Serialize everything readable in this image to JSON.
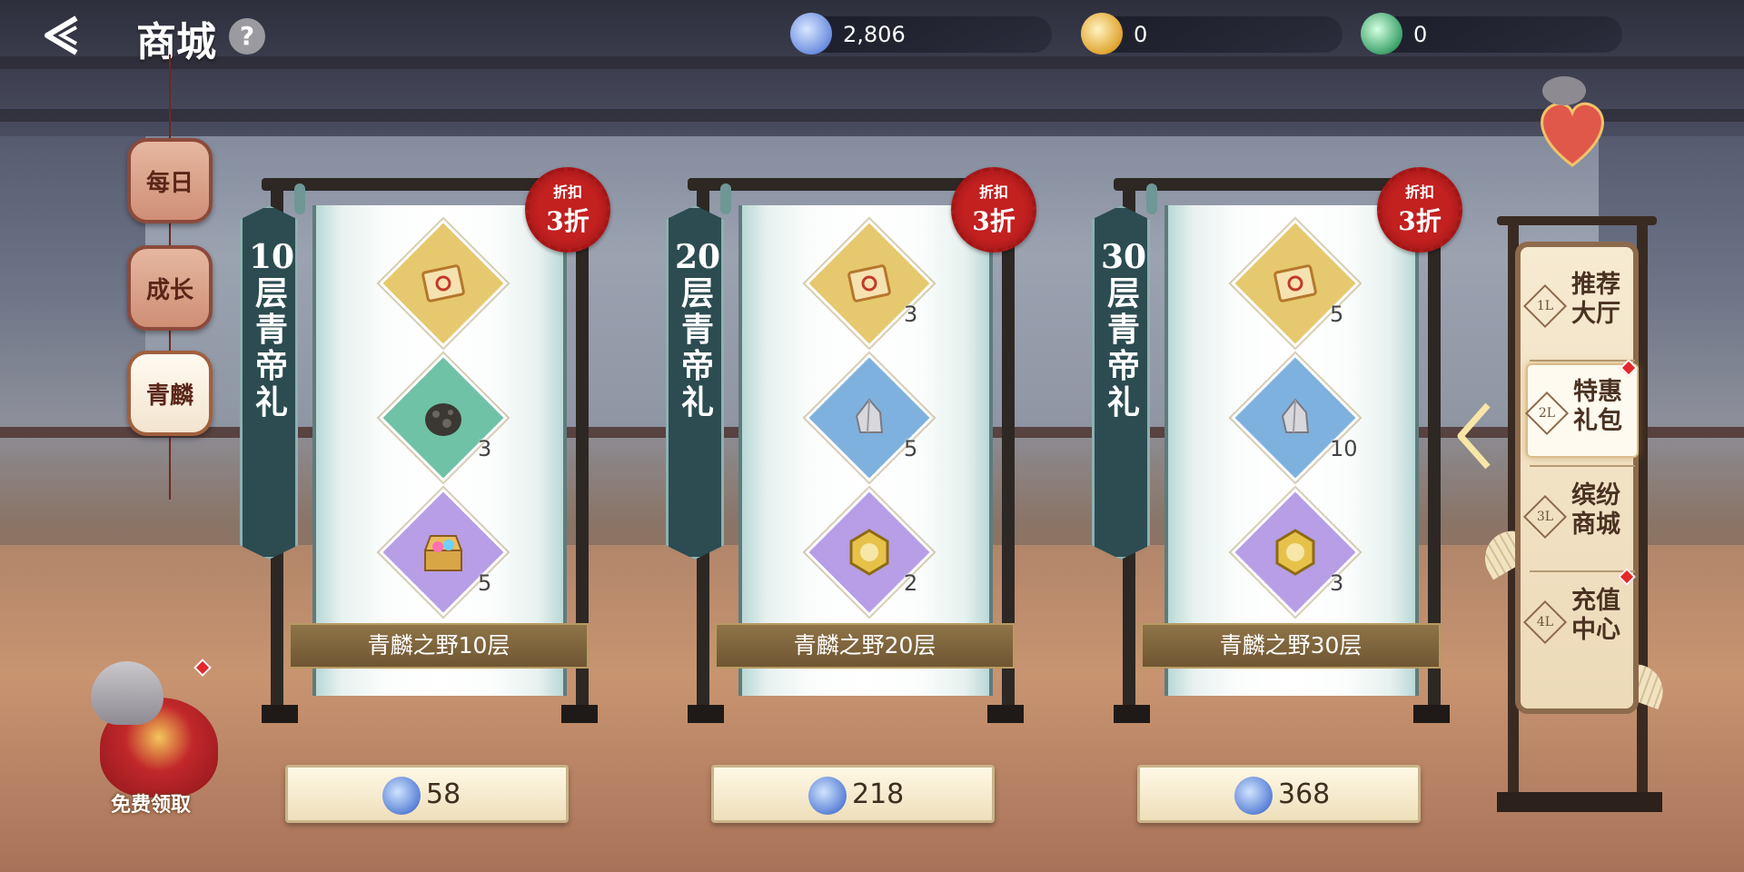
{
  "header": {
    "title": "商城",
    "help_label": "?",
    "currencies": [
      {
        "icon": "dragon-jade-icon",
        "value": "2,806",
        "color": "#6d8fe0"
      },
      {
        "icon": "gold-coin-icon",
        "value": "0",
        "color": "#e0a531"
      },
      {
        "icon": "green-orb-icon",
        "value": "0",
        "color": "#3fa36b"
      }
    ]
  },
  "categories": [
    {
      "label": "每日",
      "active": false
    },
    {
      "label": "成长",
      "active": false
    },
    {
      "label": "青麟",
      "active": true
    }
  ],
  "packages": [
    {
      "banner": "10层青帝礼",
      "badge_top": "折扣",
      "badge_bottom": "3折",
      "items": [
        {
          "icon": "ticket-icon",
          "qty": "",
          "bg": "#e6c86e"
        },
        {
          "icon": "ore-stone-icon",
          "qty": "3",
          "bg": "#6fc2a6"
        },
        {
          "icon": "treasure-chest-icon",
          "qty": "5",
          "bg": "#b79ee6"
        }
      ],
      "floor_label": "青麟之野10层",
      "price": "58"
    },
    {
      "banner": "20层青帝礼",
      "badge_top": "折扣",
      "badge_bottom": "3折",
      "items": [
        {
          "icon": "ticket-icon",
          "qty": "3",
          "bg": "#e6c86e"
        },
        {
          "icon": "crystal-ore-icon",
          "qty": "5",
          "bg": "#7fb1de"
        },
        {
          "icon": "gold-medal-icon",
          "qty": "2",
          "bg": "#b79ee6"
        }
      ],
      "floor_label": "青麟之野20层",
      "price": "218"
    },
    {
      "banner": "30层青帝礼",
      "badge_top": "折扣",
      "badge_bottom": "3折",
      "items": [
        {
          "icon": "ticket-icon",
          "qty": "5",
          "bg": "#e6c86e"
        },
        {
          "icon": "crystal-ore-icon",
          "qty": "10",
          "bg": "#7fb1de"
        },
        {
          "icon": "gold-medal-icon",
          "qty": "3",
          "bg": "#b79ee6"
        }
      ],
      "floor_label": "青麟之野30层",
      "price": "368"
    }
  ],
  "free_claim": {
    "label": "免费领取"
  },
  "right_menu": [
    {
      "num": "1L",
      "label": "推荐大厅",
      "active": false,
      "dot": false
    },
    {
      "num": "2L",
      "label": "特惠礼包",
      "active": true,
      "dot": true
    },
    {
      "num": "3L",
      "label": "缤纷商城",
      "active": false,
      "dot": false
    },
    {
      "num": "4L",
      "label": "充值中心",
      "active": false,
      "dot": true
    }
  ]
}
